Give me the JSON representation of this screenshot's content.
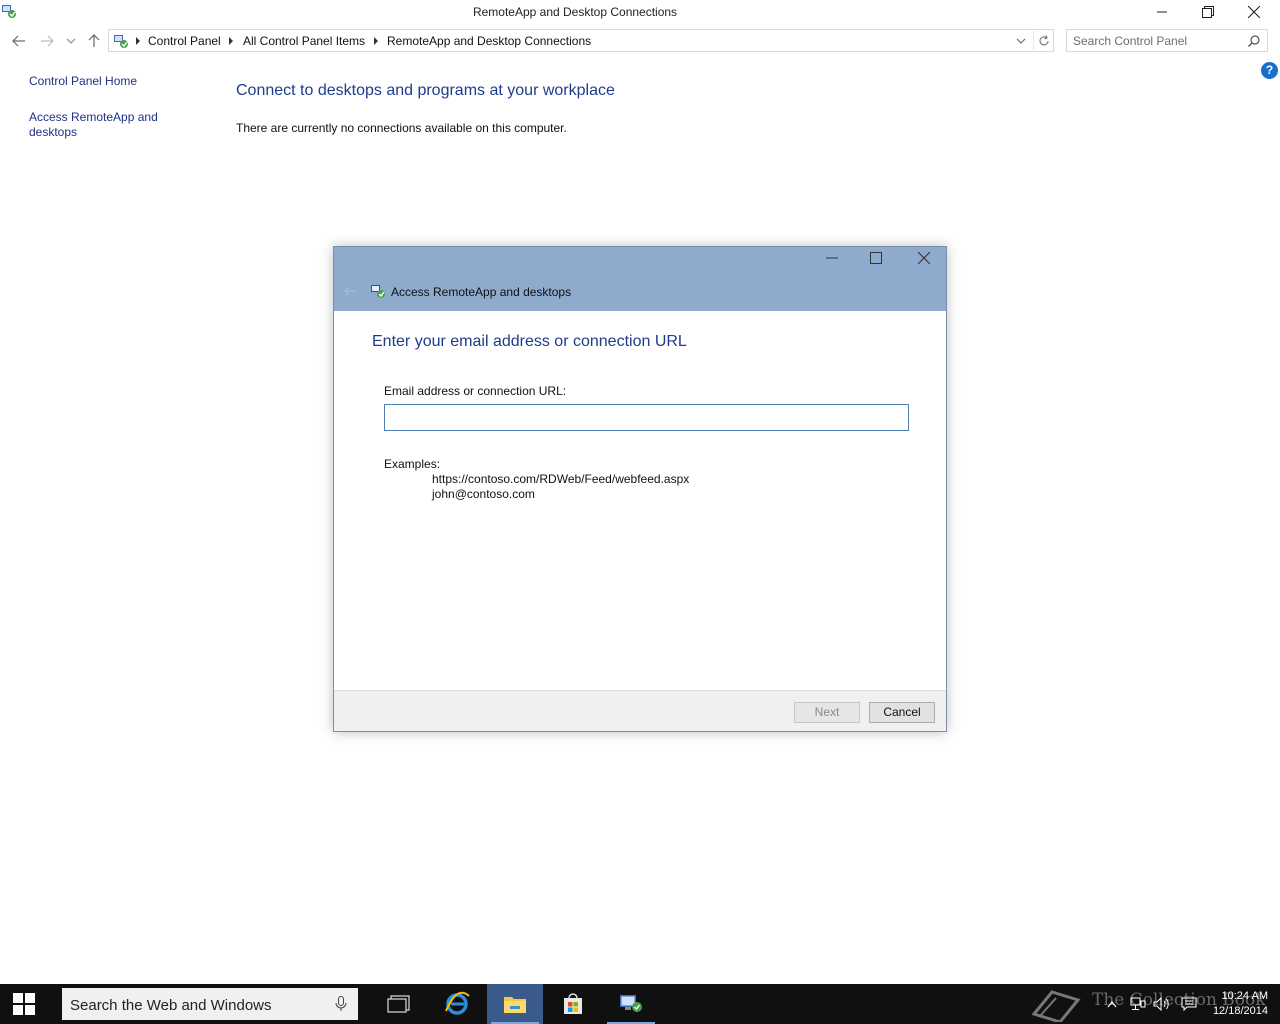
{
  "window": {
    "title": "RemoteApp and Desktop Connections"
  },
  "address": {
    "crumbs": [
      "Control Panel",
      "All Control Panel Items",
      "RemoteApp and Desktop Connections"
    ]
  },
  "search": {
    "placeholder": "Search Control Panel"
  },
  "help": {
    "label": "?"
  },
  "left_pane": {
    "home": "Control Panel Home",
    "access": "Access RemoteApp and desktops"
  },
  "main": {
    "heading": "Connect to desktops and programs at your workplace",
    "message": "There are currently no connections available on this computer."
  },
  "dialog": {
    "title": "Access RemoteApp and desktops",
    "heading": "Enter your email address or connection URL",
    "field_label": "Email address or connection URL:",
    "field_value": "",
    "examples_label": "Examples:",
    "examples": [
      "https://contoso.com/RDWeb/Feed/webfeed.aspx",
      "john@contoso.com"
    ],
    "next_label": "Next",
    "cancel_label": "Cancel"
  },
  "taskbar": {
    "search_placeholder": "Search the Web and Windows",
    "watermark": "The Collection Book",
    "time": "10:24 AM",
    "date": "12/18/2014"
  },
  "colors": {
    "link": "#1e3287",
    "heading": "#1e3c8c",
    "dialog_header": "#8eaacd",
    "taskbar": "#101010"
  }
}
